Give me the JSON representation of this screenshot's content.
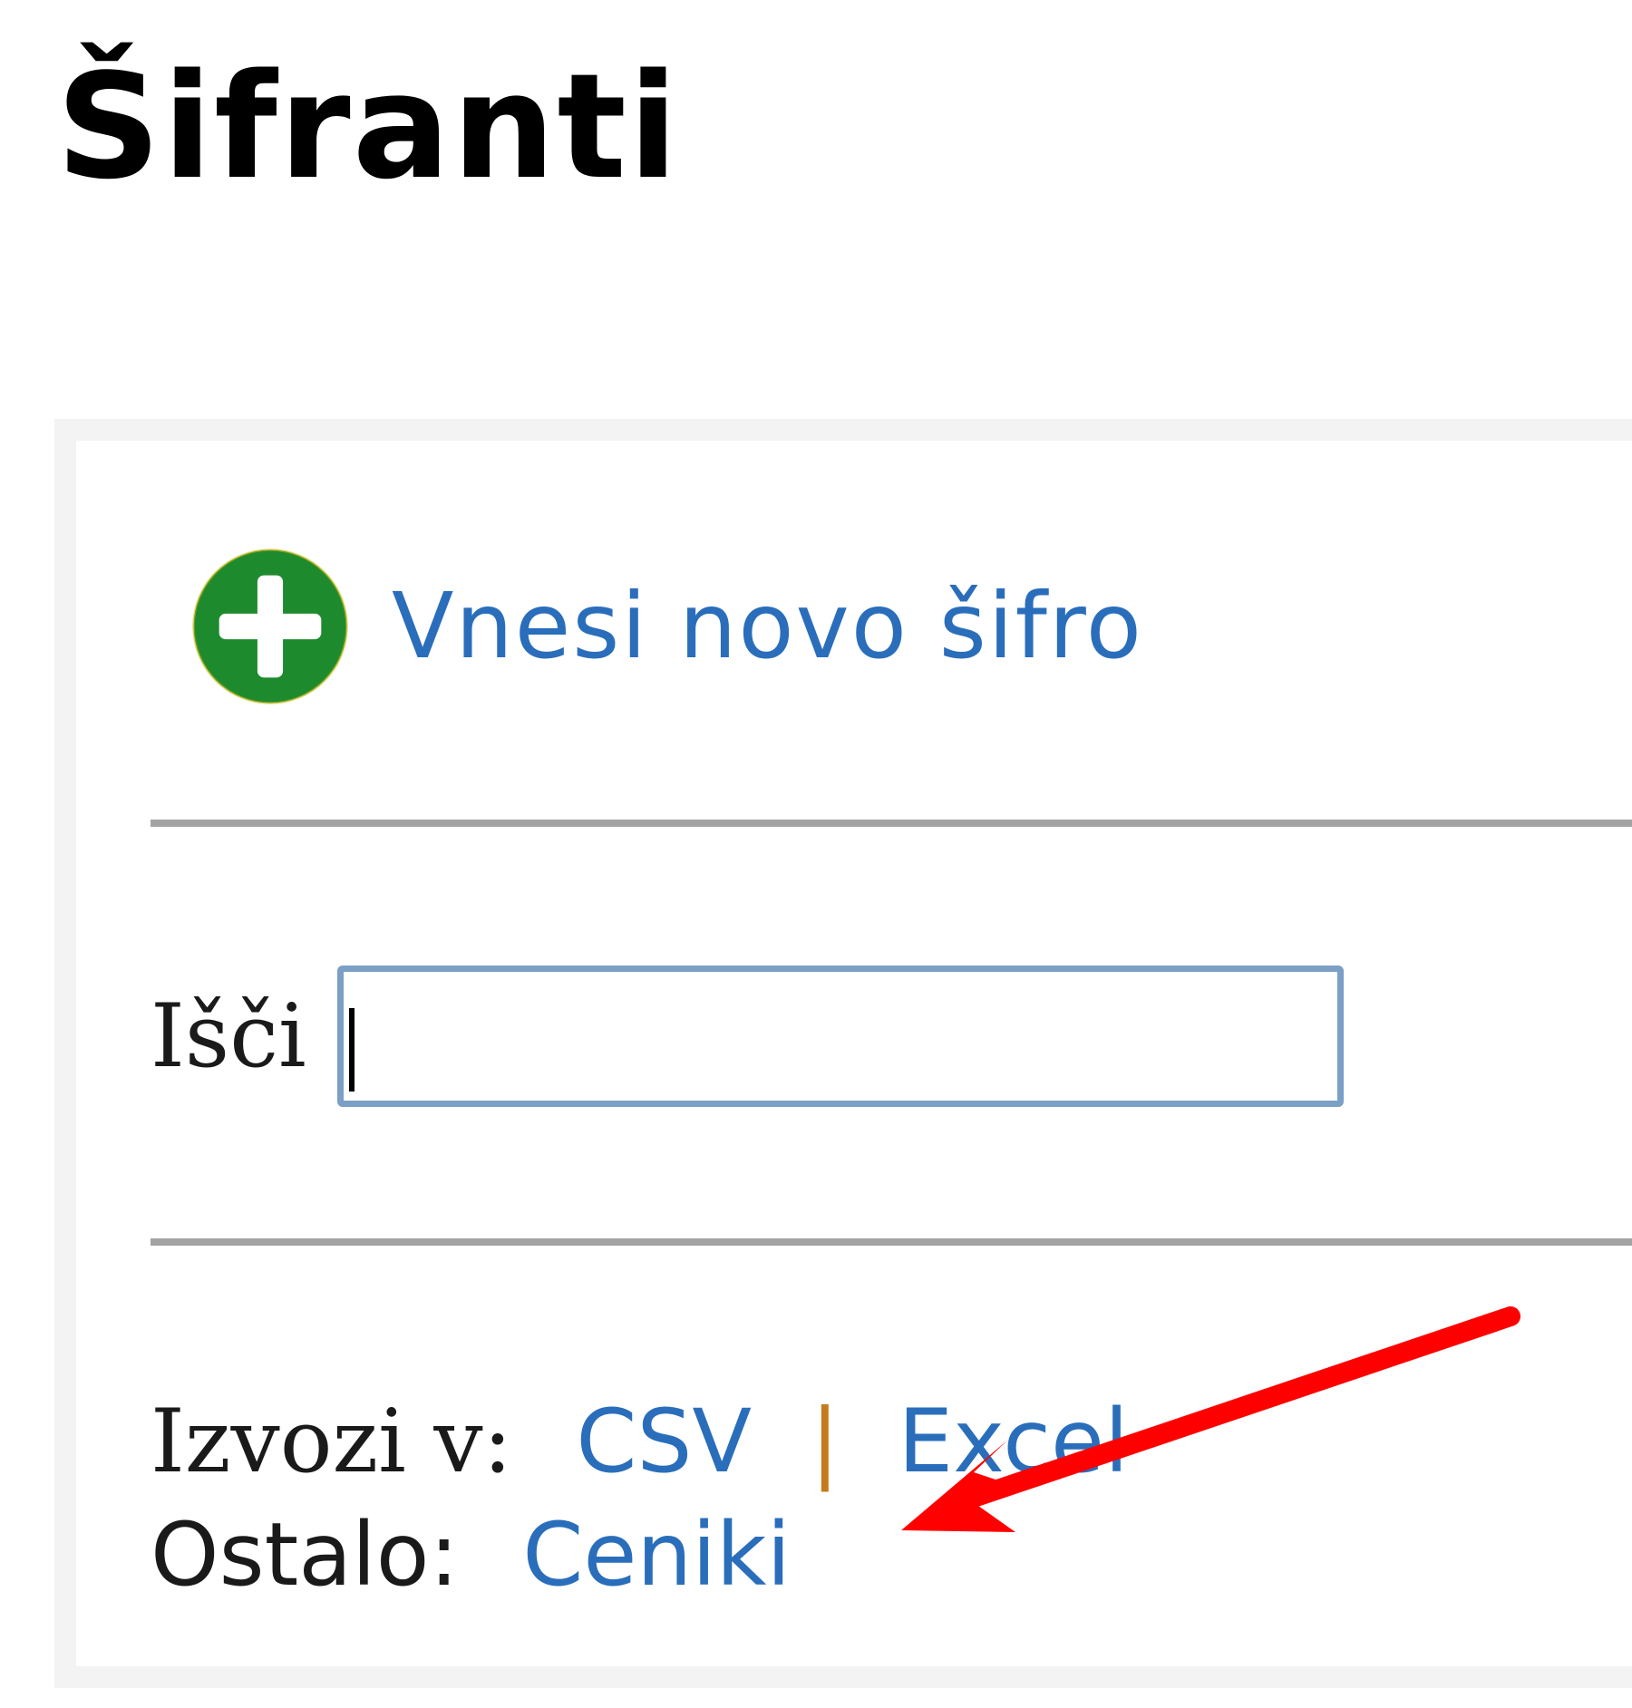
{
  "header": {
    "title": "Šifranti"
  },
  "actions": {
    "add_label": "Vnesi novo šifro",
    "add_icon": "plus-circle-icon",
    "add_icon_color": "#1e8a2e"
  },
  "search": {
    "label": "Išči",
    "value": "",
    "placeholder": ""
  },
  "export": {
    "label": "Izvozi v:",
    "separator": "|",
    "links": [
      "CSV",
      "Excel"
    ]
  },
  "other": {
    "label": "Ostalo:",
    "link": "Ceniki"
  },
  "annotation": {
    "icon": "red-arrow-icon",
    "color": "#ff0000"
  },
  "colors": {
    "link": "#2a6ebb",
    "input_border": "#7c9fc6",
    "divider": "#a3a3a3",
    "panel_bg": "#f3f3f3"
  }
}
